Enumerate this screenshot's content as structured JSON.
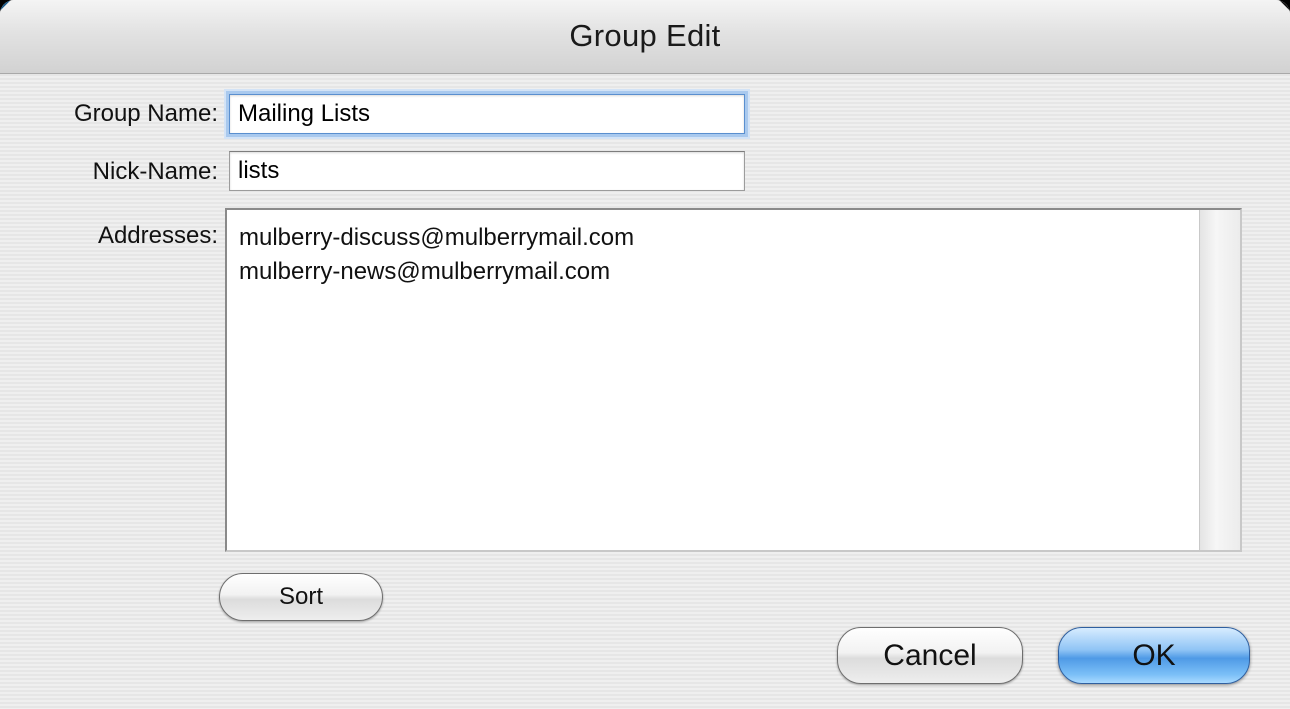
{
  "window": {
    "title": "Group Edit"
  },
  "form": {
    "group_name_label": "Group Name:",
    "group_name_value": "Mailing Lists",
    "nick_name_label": "Nick-Name:",
    "nick_name_value": "lists",
    "addresses_label": "Addresses:",
    "addresses": [
      "mulberry-discuss@mulberrymail.com",
      "mulberry-news@mulberrymail.com"
    ]
  },
  "buttons": {
    "sort_label": "Sort",
    "cancel_label": "Cancel",
    "ok_label": "OK"
  },
  "colors": {
    "default_button": "#4f9ae6",
    "focus_ring": "#a9c9ee"
  }
}
